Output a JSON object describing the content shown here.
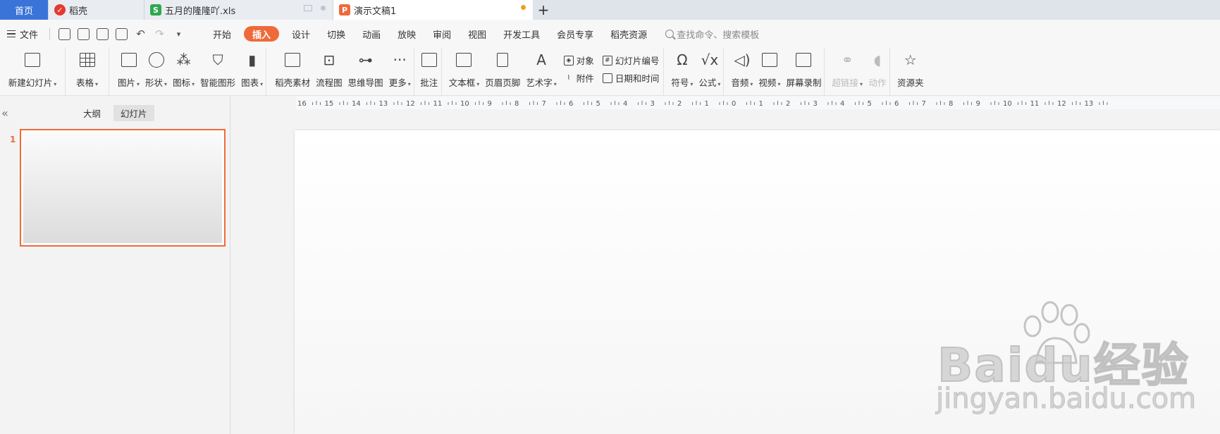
{
  "tabs": [
    {
      "label": "首页"
    },
    {
      "label": "稻壳"
    },
    {
      "label": "五月的隆隆吖.xls"
    },
    {
      "label": "演示文稿1"
    }
  ],
  "menu": {
    "file_label": "文件",
    "tabs": [
      "开始",
      "插入",
      "设计",
      "切换",
      "动画",
      "放映",
      "审阅",
      "视图",
      "开发工具",
      "会员专享",
      "稻壳资源"
    ],
    "active_tab": "插入",
    "search_placeholder": "查找命令、搜索模板"
  },
  "ribbon": {
    "new_slide": "新建幻灯片",
    "table": "表格",
    "picture": "图片",
    "shape": "形状",
    "icon": "图标",
    "smartart": "智能图形",
    "chart": "图表",
    "daoke_material": "稻壳素材",
    "flowchart": "流程图",
    "mindmap": "思维导图",
    "more": "更多",
    "comment": "批注",
    "textbox": "文本框",
    "header_footer": "页眉页脚",
    "wordart": "艺术字",
    "object": "对象",
    "attachment": "附件",
    "slide_number": "幻灯片编号",
    "datetime": "日期和时间",
    "symbol": "符号",
    "formula": "公式",
    "audio": "音频",
    "video": "视频",
    "screen_record": "屏幕录制",
    "hyperlink": "超链接",
    "action": "动作",
    "resource_folder": "资源夹"
  },
  "panel": {
    "outline_tab": "大纲",
    "slides_tab": "幻灯片",
    "slide_number": "1"
  },
  "ruler": {
    "labels": [
      "16",
      "15",
      "14",
      "13",
      "12",
      "11",
      "10",
      "9",
      "8",
      "7",
      "6",
      "5",
      "4",
      "3",
      "2",
      "1",
      "0",
      "1",
      "2",
      "3",
      "4",
      "5",
      "6",
      "7",
      "8",
      "9",
      "10",
      "11",
      "12",
      "13"
    ]
  },
  "watermark": {
    "brand": "Bai",
    "brand2": "du",
    "suffix": "经验",
    "url": "jingyan.baidu.com"
  }
}
